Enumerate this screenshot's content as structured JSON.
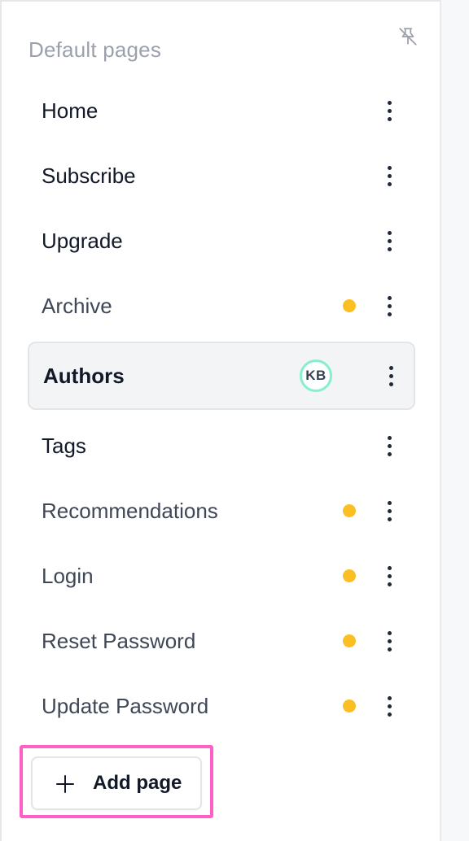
{
  "sidebar": {
    "section_title": "Default pages",
    "pin_icon": "pin-off-icon",
    "items": [
      {
        "label": "Home",
        "status": "published"
      },
      {
        "label": "Subscribe",
        "status": "published"
      },
      {
        "label": "Upgrade",
        "status": "published"
      },
      {
        "label": "Archive",
        "status": "draft"
      },
      {
        "label": "Authors",
        "status": "active",
        "avatar": "KB"
      },
      {
        "label": "Tags",
        "status": "published"
      },
      {
        "label": "Recommendations",
        "status": "draft"
      },
      {
        "label": "Login",
        "status": "draft"
      },
      {
        "label": "Reset Password",
        "status": "draft"
      },
      {
        "label": "Update Password",
        "status": "draft"
      }
    ],
    "add_button_label": "Add page"
  },
  "colors": {
    "draft_dot": "#fbbf24",
    "avatar_ring": "#86efcf",
    "highlight": "#ff5fc6",
    "active_bg": "#f3f4f6"
  }
}
